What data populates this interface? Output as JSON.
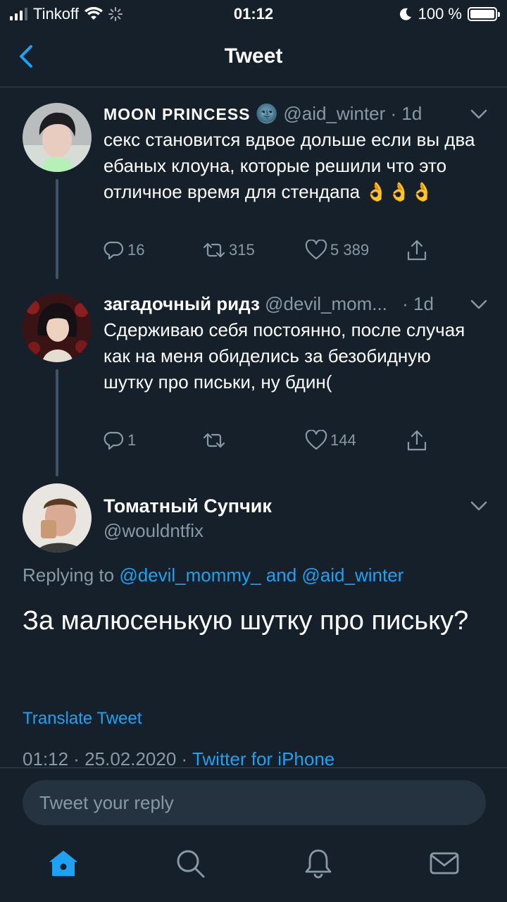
{
  "status_bar": {
    "carrier": "Tinkoff",
    "time": "01:12",
    "battery": "100 %"
  },
  "header": {
    "title": "Tweet"
  },
  "tweets": [
    {
      "name": "MOON PRINCESS",
      "emoji": "🌚",
      "handle": "@aid_winter",
      "time": "· 1d",
      "text": "секс становится вдвое дольше если вы два ебаных клоуна, которые решили что это отличное время для стендапа 👌👌👌",
      "replies": "16",
      "retweets": "315",
      "likes": "5 389"
    },
    {
      "name": "загадочный ридз",
      "handle": "@devil_mom...",
      "time": "· 1d",
      "text": "Сдерживаю себя постоянно, после случая как на меня обиделись за безобидную шутку про письки, ну бдин(",
      "replies": "1",
      "retweets": "",
      "likes": "144"
    }
  ],
  "main_tweet": {
    "name": "Томатный Супчик",
    "handle": "@wouldntfix",
    "replying_prefix": "Replying to",
    "reply_user_1": "@devil_mommy_",
    "reply_and": "and",
    "reply_user_2": "@aid_winter",
    "text": "За малюсенькую шутку про письку?",
    "translate": "Translate Tweet",
    "timestamp": "01:12 · 25.02.2020 ·",
    "client": "Twitter for iPhone"
  },
  "reply_box": {
    "placeholder": "Tweet your reply"
  },
  "colors": {
    "background": "#15202b",
    "accent": "#1da1f2",
    "secondary_text": "#8899a6",
    "divider": "#38444d"
  },
  "icons": [
    "back-chevron-icon",
    "reply-icon",
    "retweet-icon",
    "like-icon",
    "share-icon",
    "home-icon",
    "search-icon",
    "notifications-icon",
    "messages-icon"
  ]
}
